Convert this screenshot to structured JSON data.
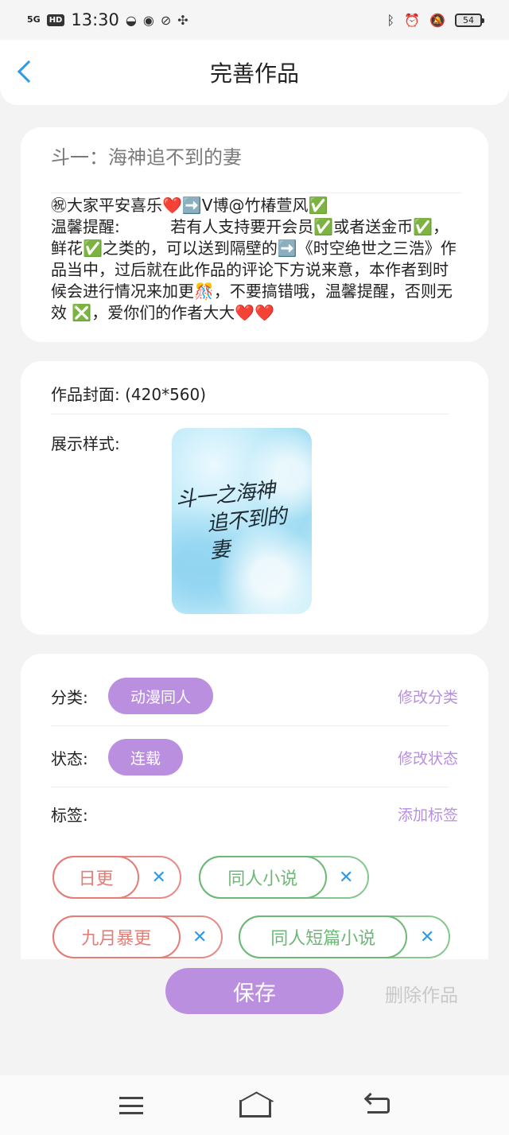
{
  "status_bar": {
    "signal": "5G",
    "hd_badge": "HD",
    "time": "13:30",
    "battery": "54"
  },
  "header": {
    "title": "完善作品"
  },
  "work": {
    "title": "斗一：海神追不到的妻",
    "description": "㊗大家平安喜乐❤️➡️V博@竹椿萱风✅\n温馨提醒:          若有人支持要开会员✅或者送金币✅，鲜花✅之类的，可以送到隔壁的➡️《时空绝世之三浩》作品当中，过后就在此作品的评论下方说来意，本作者到时候会进行情况来加更🎊，不要搞错哦，温馨提醒，否则无效 ❎，爱你们的作者大大❤️❤️"
  },
  "cover": {
    "label": "作品封面: (420*560)",
    "style_label": "展示样式:",
    "image_text_line1": "斗一之海神",
    "image_text_line2": "追不到的妻"
  },
  "meta": {
    "category_label": "分类:",
    "category_value": "动漫同人",
    "category_action": "修改分类",
    "status_label": "状态:",
    "status_value": "连载",
    "status_action": "修改状态",
    "tags_label": "标签:",
    "tags_action": "添加标签",
    "tags": [
      {
        "text": "日更",
        "color": "#e57c76"
      },
      {
        "text": "同人小说",
        "color": "#6cb877"
      },
      {
        "text": "九月暴更",
        "color": "#e57c76"
      },
      {
        "text": "同人短篇小说",
        "color": "#6cb877"
      }
    ],
    "tag_remove_symbol": "✕"
  },
  "actions": {
    "save": "保存",
    "delete": "删除作品"
  },
  "icons": {
    "back": "chevron-left-icon",
    "nav_menu": "menu-icon",
    "nav_home": "home-icon",
    "nav_back": "back-icon"
  }
}
